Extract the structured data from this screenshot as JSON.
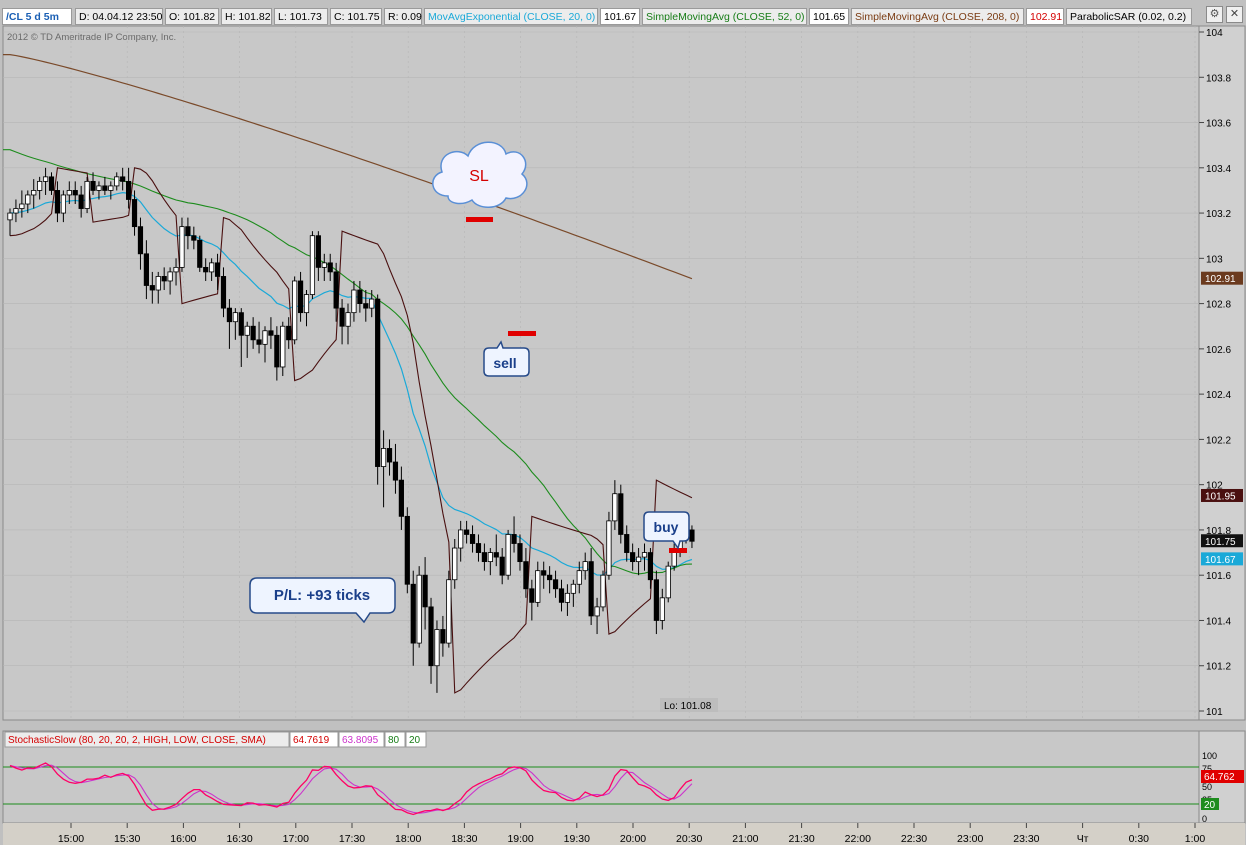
{
  "header": {
    "symbol": "/CL 5 d 5m",
    "date": "D: 04.04.12 23:50",
    "open": "O: 101.82",
    "high": "H: 101.82",
    "low": "L: 101.73",
    "close": "C: 101.75",
    "range": "R: 0.09",
    "ema_label": "MovAvgExponential (CLOSE, 20, 0)",
    "ema_value": "101.67",
    "sma52_label": "SimpleMovingAvg (CLOSE, 52, 0)",
    "sma52_value": "101.65",
    "sma208_label": "SimpleMovingAvg (CLOSE, 208, 0)",
    "sma208_value": "102.91",
    "psar_label": "ParabolicSAR (0.02, 0.2)"
  },
  "copyright": "2012 © TD Ameritrade IP Company, Inc.",
  "annotations": {
    "sl": "SL",
    "sell": "sell",
    "buy": "buy",
    "pl": "P/L: +93 ticks",
    "low_label": "Lo: 101.08"
  },
  "price_badges": [
    {
      "value": "102.91",
      "y": 102.91,
      "bg": "#6b3a1e",
      "fg": "#ffffff"
    },
    {
      "value": "101.95",
      "y": 101.95,
      "bg": "#4a1010",
      "fg": "#ffffff"
    },
    {
      "value": "101.75",
      "y": 101.75,
      "bg": "#111111",
      "fg": "#ffffff"
    },
    {
      "value": "101.67",
      "y": 101.67,
      "bg": "#1aa9d8",
      "fg": "#ffffff"
    }
  ],
  "stoch": {
    "label": "StochasticSlow (80, 20, 20, 2, HIGH, LOW, CLOSE, SMA)",
    "k_value": "64.7619",
    "d_value": "63.8095",
    "over_bought": "80",
    "over_sold": "20",
    "badge_k": "64.762",
    "badge_os": "20",
    "y_ticks": [
      "100",
      "75",
      "50",
      "25",
      "0"
    ]
  },
  "colors": {
    "up_candle": "#ffffff",
    "down_candle": "#000000",
    "ema": "#1aa9d8",
    "sma52": "#1d8c1d",
    "sma208": "#7a4a2a",
    "psar": "#4a1010",
    "stoch_k": "#ff0066",
    "stoch_d": "#cc33cc",
    "stoch_lines": "#1d8c1d"
  },
  "chart_data": {
    "type": "candlestick",
    "interval": "5 min",
    "y_range": [
      101.0,
      104.0
    ],
    "y_ticks": [
      "104",
      "103.8",
      "103.6",
      "103.4",
      "103.2",
      "103",
      "102.8",
      "102.6",
      "102.4",
      "102.2",
      "102",
      "101.8",
      "101.6",
      "101.4",
      "101.2",
      "101"
    ],
    "x_ticks": [
      "15:00",
      "15:30",
      "16:00",
      "16:30",
      "17:00",
      "17:30",
      "18:00",
      "18:30",
      "19:00",
      "19:30",
      "20:00",
      "20:30",
      "21:00",
      "21:30",
      "22:00",
      "22:30",
      "23:00",
      "23:30",
      "Чт",
      "0:30",
      "1:00"
    ],
    "candles_ohlc": [
      [
        103.17,
        103.22,
        103.1,
        103.2
      ],
      [
        103.2,
        103.26,
        103.16,
        103.22
      ],
      [
        103.22,
        103.3,
        103.18,
        103.24
      ],
      [
        103.24,
        103.3,
        103.2,
        103.28
      ],
      [
        103.28,
        103.35,
        103.22,
        103.3
      ],
      [
        103.3,
        103.36,
        103.26,
        103.34
      ],
      [
        103.34,
        103.4,
        103.28,
        103.36
      ],
      [
        103.36,
        103.38,
        103.28,
        103.3
      ],
      [
        103.3,
        103.34,
        103.16,
        103.2
      ],
      [
        103.2,
        103.3,
        103.16,
        103.28
      ],
      [
        103.28,
        103.34,
        103.24,
        103.3
      ],
      [
        103.3,
        103.34,
        103.24,
        103.28
      ],
      [
        103.28,
        103.32,
        103.18,
        103.22
      ],
      [
        103.22,
        103.36,
        103.2,
        103.34
      ],
      [
        103.34,
        103.38,
        103.28,
        103.3
      ],
      [
        103.3,
        103.34,
        103.26,
        103.32
      ],
      [
        103.32,
        103.36,
        103.28,
        103.3
      ],
      [
        103.3,
        103.34,
        103.26,
        103.32
      ],
      [
        103.32,
        103.38,
        103.3,
        103.36
      ],
      [
        103.36,
        103.4,
        103.3,
        103.34
      ],
      [
        103.34,
        103.4,
        103.22,
        103.26
      ],
      [
        103.26,
        103.3,
        103.1,
        103.14
      ],
      [
        103.14,
        103.18,
        102.95,
        103.02
      ],
      [
        103.02,
        103.08,
        102.82,
        102.88
      ],
      [
        102.88,
        102.94,
        102.8,
        102.86
      ],
      [
        102.86,
        102.94,
        102.8,
        102.92
      ],
      [
        102.92,
        102.96,
        102.86,
        102.9
      ],
      [
        102.9,
        102.96,
        102.84,
        102.94
      ],
      [
        102.94,
        103.0,
        102.88,
        102.96
      ],
      [
        102.96,
        103.18,
        102.94,
        103.14
      ],
      [
        103.14,
        103.18,
        103.04,
        103.1
      ],
      [
        103.1,
        103.14,
        103.04,
        103.08
      ],
      [
        103.08,
        103.1,
        102.94,
        102.96
      ],
      [
        102.96,
        103.0,
        102.9,
        102.94
      ],
      [
        102.94,
        103.0,
        102.9,
        102.98
      ],
      [
        102.98,
        103.02,
        102.86,
        102.92
      ],
      [
        102.92,
        102.96,
        102.74,
        102.78
      ],
      [
        102.78,
        102.82,
        102.6,
        102.72
      ],
      [
        102.72,
        102.78,
        102.64,
        102.76
      ],
      [
        102.76,
        102.78,
        102.52,
        102.66
      ],
      [
        102.66,
        102.72,
        102.56,
        102.7
      ],
      [
        102.7,
        102.74,
        102.6,
        102.64
      ],
      [
        102.64,
        102.72,
        102.58,
        102.62
      ],
      [
        102.62,
        102.7,
        102.54,
        102.68
      ],
      [
        102.68,
        102.74,
        102.6,
        102.66
      ],
      [
        102.66,
        102.7,
        102.46,
        102.52
      ],
      [
        102.52,
        102.72,
        102.48,
        102.7
      ],
      [
        102.7,
        102.74,
        102.6,
        102.64
      ],
      [
        102.64,
        102.92,
        102.62,
        102.9
      ],
      [
        102.9,
        102.94,
        102.72,
        102.76
      ],
      [
        102.76,
        102.86,
        102.7,
        102.84
      ],
      [
        102.84,
        103.12,
        102.82,
        103.1
      ],
      [
        103.1,
        103.12,
        102.9,
        102.96
      ],
      [
        102.96,
        103.02,
        102.9,
        102.98
      ],
      [
        102.98,
        103.02,
        102.9,
        102.94
      ],
      [
        102.94,
        102.98,
        102.72,
        102.78
      ],
      [
        102.78,
        102.82,
        102.62,
        102.7
      ],
      [
        102.7,
        102.8,
        102.62,
        102.76
      ],
      [
        102.76,
        102.9,
        102.72,
        102.86
      ],
      [
        102.86,
        102.9,
        102.76,
        102.8
      ],
      [
        102.8,
        102.86,
        102.72,
        102.78
      ],
      [
        102.78,
        102.86,
        102.74,
        102.82
      ],
      [
        102.82,
        102.84,
        102.0,
        102.08
      ],
      [
        102.08,
        102.24,
        101.9,
        102.16
      ],
      [
        102.16,
        102.2,
        102.04,
        102.1
      ],
      [
        102.1,
        102.18,
        101.96,
        102.02
      ],
      [
        102.02,
        102.08,
        101.8,
        101.86
      ],
      [
        101.86,
        101.9,
        101.52,
        101.56
      ],
      [
        101.56,
        101.62,
        101.2,
        101.3
      ],
      [
        101.3,
        101.64,
        101.28,
        101.6
      ],
      [
        101.6,
        101.68,
        101.36,
        101.46
      ],
      [
        101.46,
        101.5,
        101.12,
        101.2
      ],
      [
        101.2,
        101.4,
        101.08,
        101.36
      ],
      [
        101.36,
        101.42,
        101.24,
        101.3
      ],
      [
        101.3,
        101.62,
        101.28,
        101.58
      ],
      [
        101.58,
        101.76,
        101.54,
        101.72
      ],
      [
        101.72,
        101.84,
        101.66,
        101.8
      ],
      [
        101.8,
        101.84,
        101.74,
        101.78
      ],
      [
        101.78,
        101.82,
        101.7,
        101.74
      ],
      [
        101.74,
        101.78,
        101.66,
        101.7
      ],
      [
        101.7,
        101.74,
        101.62,
        101.66
      ],
      [
        101.66,
        101.72,
        101.6,
        101.7
      ],
      [
        101.7,
        101.78,
        101.64,
        101.68
      ],
      [
        101.68,
        101.72,
        101.56,
        101.6
      ],
      [
        101.6,
        101.8,
        101.58,
        101.78
      ],
      [
        101.78,
        101.86,
        101.7,
        101.74
      ],
      [
        101.74,
        101.78,
        101.62,
        101.66
      ],
      [
        101.66,
        101.72,
        101.5,
        101.54
      ],
      [
        101.54,
        101.58,
        101.4,
        101.48
      ],
      [
        101.48,
        101.66,
        101.46,
        101.62
      ],
      [
        101.62,
        101.66,
        101.54,
        101.6
      ],
      [
        101.6,
        101.64,
        101.52,
        101.58
      ],
      [
        101.58,
        101.62,
        101.5,
        101.54
      ],
      [
        101.54,
        101.58,
        101.44,
        101.48
      ],
      [
        101.48,
        101.56,
        101.42,
        101.52
      ],
      [
        101.52,
        101.58,
        101.46,
        101.56
      ],
      [
        101.56,
        101.66,
        101.52,
        101.62
      ],
      [
        101.62,
        101.7,
        101.58,
        101.66
      ],
      [
        101.66,
        101.72,
        101.38,
        101.42
      ],
      [
        101.42,
        101.5,
        101.34,
        101.46
      ],
      [
        101.46,
        101.62,
        101.44,
        101.6
      ],
      [
        101.6,
        101.88,
        101.58,
        101.84
      ],
      [
        101.84,
        102.02,
        101.8,
        101.96
      ],
      [
        101.96,
        102.0,
        101.74,
        101.78
      ],
      [
        101.78,
        101.82,
        101.66,
        101.7
      ],
      [
        101.7,
        101.74,
        101.62,
        101.66
      ],
      [
        101.66,
        101.72,
        101.6,
        101.68
      ],
      [
        101.68,
        101.74,
        101.62,
        101.7
      ],
      [
        101.7,
        101.72,
        101.54,
        101.58
      ],
      [
        101.58,
        101.62,
        101.34,
        101.4
      ],
      [
        101.4,
        101.54,
        101.36,
        101.5
      ],
      [
        101.5,
        101.66,
        101.48,
        101.64
      ],
      [
        101.64,
        101.74,
        101.62,
        101.7
      ],
      [
        101.7,
        101.78,
        101.68,
        101.76
      ],
      [
        101.76,
        101.84,
        101.74,
        101.8
      ],
      [
        101.8,
        101.82,
        101.72,
        101.75
      ]
    ]
  }
}
